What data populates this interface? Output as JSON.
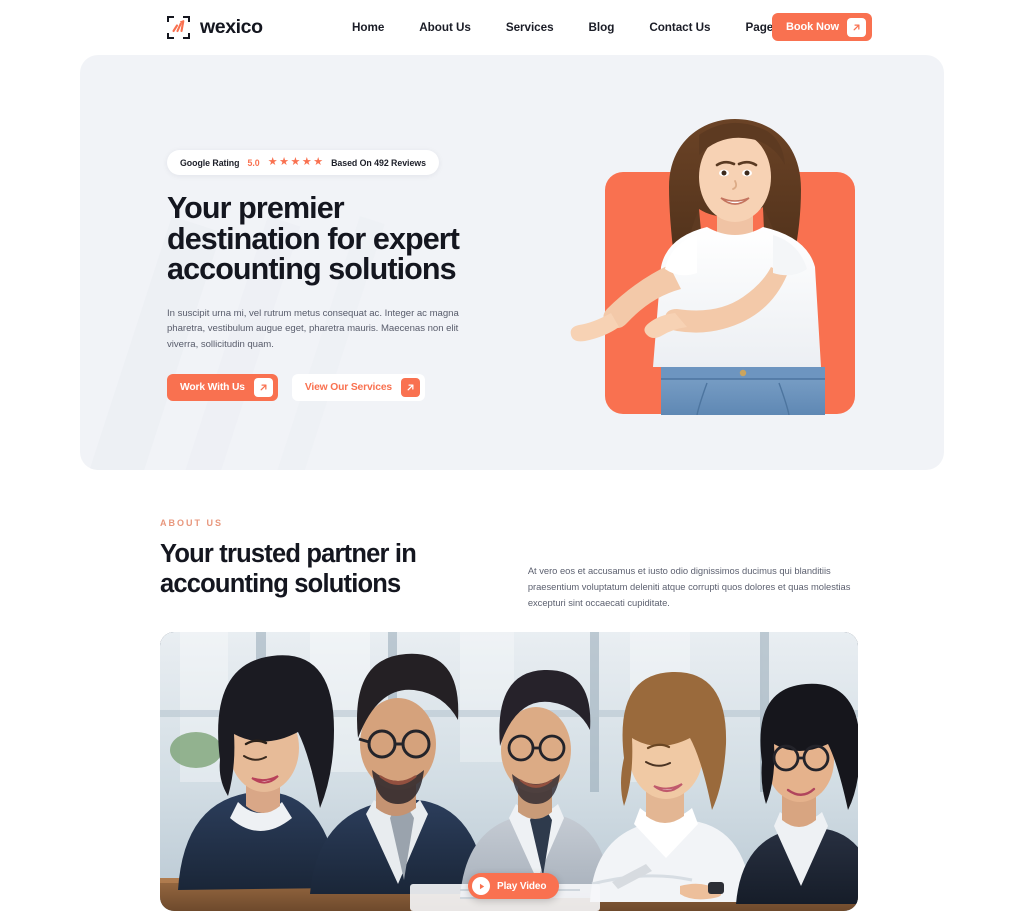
{
  "header": {
    "brand_name": "wexico",
    "logo_icon": "chart-bracket-icon",
    "nav": [
      {
        "label": "Home",
        "icon": null
      },
      {
        "label": "About Us",
        "icon": null
      },
      {
        "label": "Services",
        "icon": null
      },
      {
        "label": "Blog",
        "icon": null
      },
      {
        "label": "Contact Us",
        "icon": null
      },
      {
        "label": "Pages",
        "icon": "chevron-down-icon"
      }
    ],
    "book_button": {
      "label": "Book Now",
      "icon": "arrow-up-right-icon"
    }
  },
  "hero": {
    "rating": {
      "label": "Google Rating",
      "score": "5.0",
      "stars": 5,
      "star_glyph": "★",
      "reviews": "Based On 492 Reviews"
    },
    "title": "Your premier destination for expert accounting solutions",
    "description": "In suscipit urna mi, vel rutrum metus consequat ac. Integer ac magna pharetra, vestibulum augue eget, pharetra mauris. Maecenas non elit viverra, sollicitudin quam.",
    "buttons": [
      {
        "label": "Work With Us",
        "icon": "arrow-up-right-icon",
        "style": "primary"
      },
      {
        "label": "View Our Services",
        "icon": "arrow-up-right-icon",
        "style": "ghost"
      }
    ],
    "image_alt": "woman-pointing-photo"
  },
  "about": {
    "eyebrow": "ABOUT US",
    "title": "Your trusted partner in accounting solutions",
    "description": "At vero eos et accusamus et iusto odio dignissimos ducimus qui blanditiis praesentium voluptatum deleniti atque corrupti quos dolores et quas molestias excepturi sint occaecati cupiditate."
  },
  "video": {
    "play_label": "Play Video",
    "play_icon": "play-triangle-icon",
    "image_alt": "business-team-meeting-photo"
  },
  "colors": {
    "accent": "#f97150",
    "hero_background": "#f1f3f7",
    "text_dark": "#14161f",
    "text_muted": "#5d6170",
    "eyebrow": "#e8977d",
    "page_background": "#ffffff"
  }
}
